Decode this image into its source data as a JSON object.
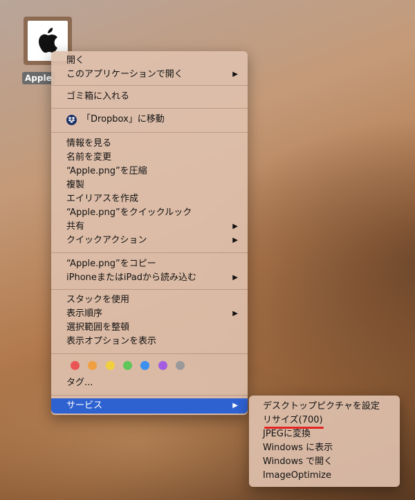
{
  "desktop": {
    "file_label": "Apple.",
    "icon": "apple-logo-icon"
  },
  "menu": {
    "open": "開く",
    "open_with": "このアプリケーションで開く",
    "trash": "ゴミ箱に入れる",
    "dropbox_move": "「Dropbox」に移動",
    "get_info": "情報を見る",
    "rename": "名前を変更",
    "compress": "“Apple.png”を圧縮",
    "duplicate": "複製",
    "make_alias": "エイリアスを作成",
    "quick_look": "“Apple.png”をクイックルック",
    "share": "共有",
    "quick_actions": "クイックアクション",
    "copy": "“Apple.png”をコピー",
    "import_iphone": "iPhoneまたはiPadから読み込む",
    "use_stacks": "スタックを使用",
    "sort_by": "表示順序",
    "clean_up": "選択範囲を整頓",
    "view_options": "表示オプションを表示",
    "tags": "タグ...",
    "services": "サービス",
    "arrow": "▶"
  },
  "tag_colors": [
    "#e95454",
    "#f0a040",
    "#f2cf3e",
    "#5fc65a",
    "#3d8ff0",
    "#a35de0",
    "#9a9a9a"
  ],
  "submenu": {
    "set_desktop": "デスクトップピクチャを設定",
    "resize": "リサイズ(700)",
    "to_jpeg": "JPEGに変換",
    "show_windows": "Windows に表示",
    "open_windows": "Windows で開く",
    "image_optimize": "ImageOptimize"
  },
  "accent": {
    "highlight": "#2f62d1",
    "underline": "#e32323"
  }
}
